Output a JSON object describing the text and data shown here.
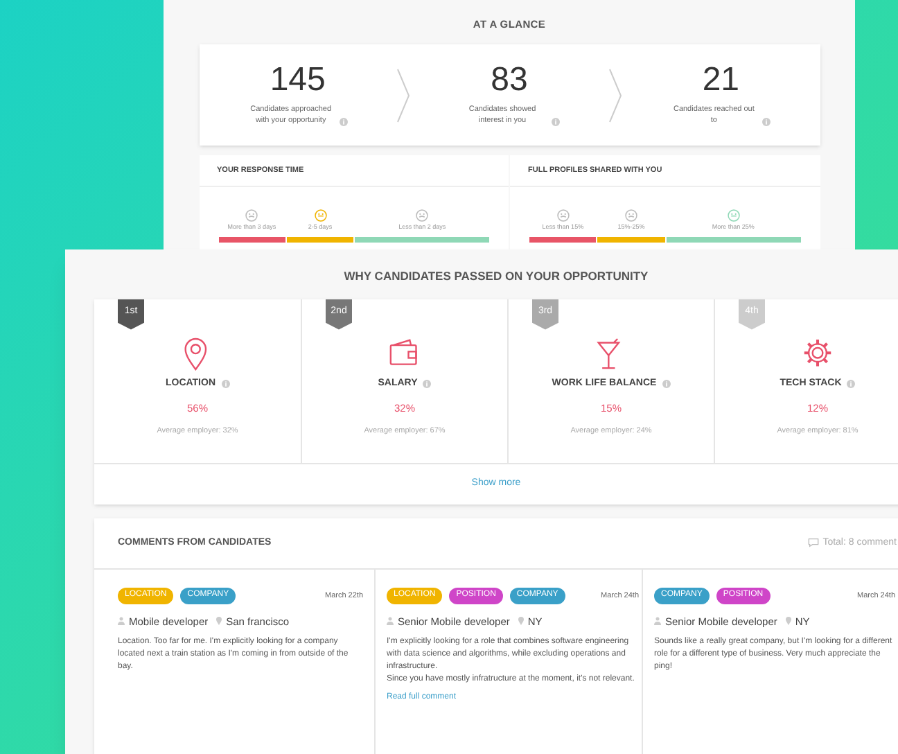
{
  "glance": {
    "title": "AT A GLANCE",
    "stats": [
      {
        "value": "145",
        "label": "Candidates approached with your opportunity"
      },
      {
        "value": "83",
        "label": "Candidates showed interest in you"
      },
      {
        "value": "21",
        "label": "Candidates reached out to"
      }
    ],
    "panels": [
      {
        "title": "YOUR RESPONSE TIME",
        "segments": [
          {
            "label": "More than 3 days",
            "color": "#e85567",
            "selected": false
          },
          {
            "label": "2-5 days",
            "color": "#f0b400",
            "selected": true
          },
          {
            "label": "Less than 2 days",
            "color": "#8fd8b6",
            "selected": false
          }
        ]
      },
      {
        "title": "FULL PROFILES SHARED WITH YOU",
        "segments": [
          {
            "label": "Less than 15%",
            "color": "#e85567",
            "selected": false
          },
          {
            "label": "15%-25%",
            "color": "#f0b400",
            "selected": false
          },
          {
            "label": "More than 25%",
            "color": "#8fd8b6",
            "selected": true
          }
        ]
      }
    ]
  },
  "reasons": {
    "title": "WHY CANDIDATES PASSED ON YOUR OPPORTUNITY",
    "items": [
      {
        "rank": "1st",
        "color": "#555555",
        "kind": "pin",
        "label": "LOCATION",
        "percent": "56%",
        "average": "Average employer: 32%"
      },
      {
        "rank": "2nd",
        "color": "#777777",
        "kind": "wallet",
        "label": "SALARY",
        "percent": "32%",
        "average": "Average employer: 67%"
      },
      {
        "rank": "3rd",
        "color": "#aaaaaa",
        "kind": "glass",
        "label": "WORK LIFE BALANCE",
        "percent": "15%",
        "average": "Average employer: 24%"
      },
      {
        "rank": "4th",
        "color": "#cccccc",
        "kind": "gear",
        "label": "TECH STACK",
        "percent": "12%",
        "average": "Average employer: 81%"
      }
    ],
    "show_more": "Show more"
  },
  "comments": {
    "title": "COMMENTS FROM CANDIDATES",
    "total": "Total: 8 comment",
    "items": [
      {
        "tags": [
          {
            "label": "LOCATION",
            "color": "#f0b400"
          },
          {
            "label": "COMPANY",
            "color": "#3aa0c8"
          }
        ],
        "date": "March 22th",
        "role": "Mobile developer",
        "place": "San francisco",
        "paragraphs": [
          "Location. Too far for me. I'm explicitly looking for a company located next a train station as I'm coming in from outside of the bay."
        ]
      },
      {
        "tags": [
          {
            "label": "LOCATION",
            "color": "#f0b400"
          },
          {
            "label": "POSITION",
            "color": "#cf45c8"
          },
          {
            "label": "COMPANY",
            "color": "#3aa0c8"
          }
        ],
        "date": "March 24th",
        "role": "Senior Mobile developer",
        "place": "NY",
        "paragraphs": [
          "I'm explicitly looking for a role that combines software engineering with data science and algorithms, while excluding operations and infrastructure.",
          "Since you have mostly infratructure at the moment, it's not relevant."
        ],
        "link": "Read full comment"
      },
      {
        "tags": [
          {
            "label": "COMPANY",
            "color": "#3aa0c8"
          },
          {
            "label": "POSITION",
            "color": "#cf45c8"
          }
        ],
        "date": "March 24th",
        "role": "Senior Mobile developer",
        "place": "NY",
        "paragraphs": [
          "Sounds like a really great company, but I'm looking for a different role for a different type of business. Very much appreciate the ping!"
        ]
      }
    ]
  }
}
